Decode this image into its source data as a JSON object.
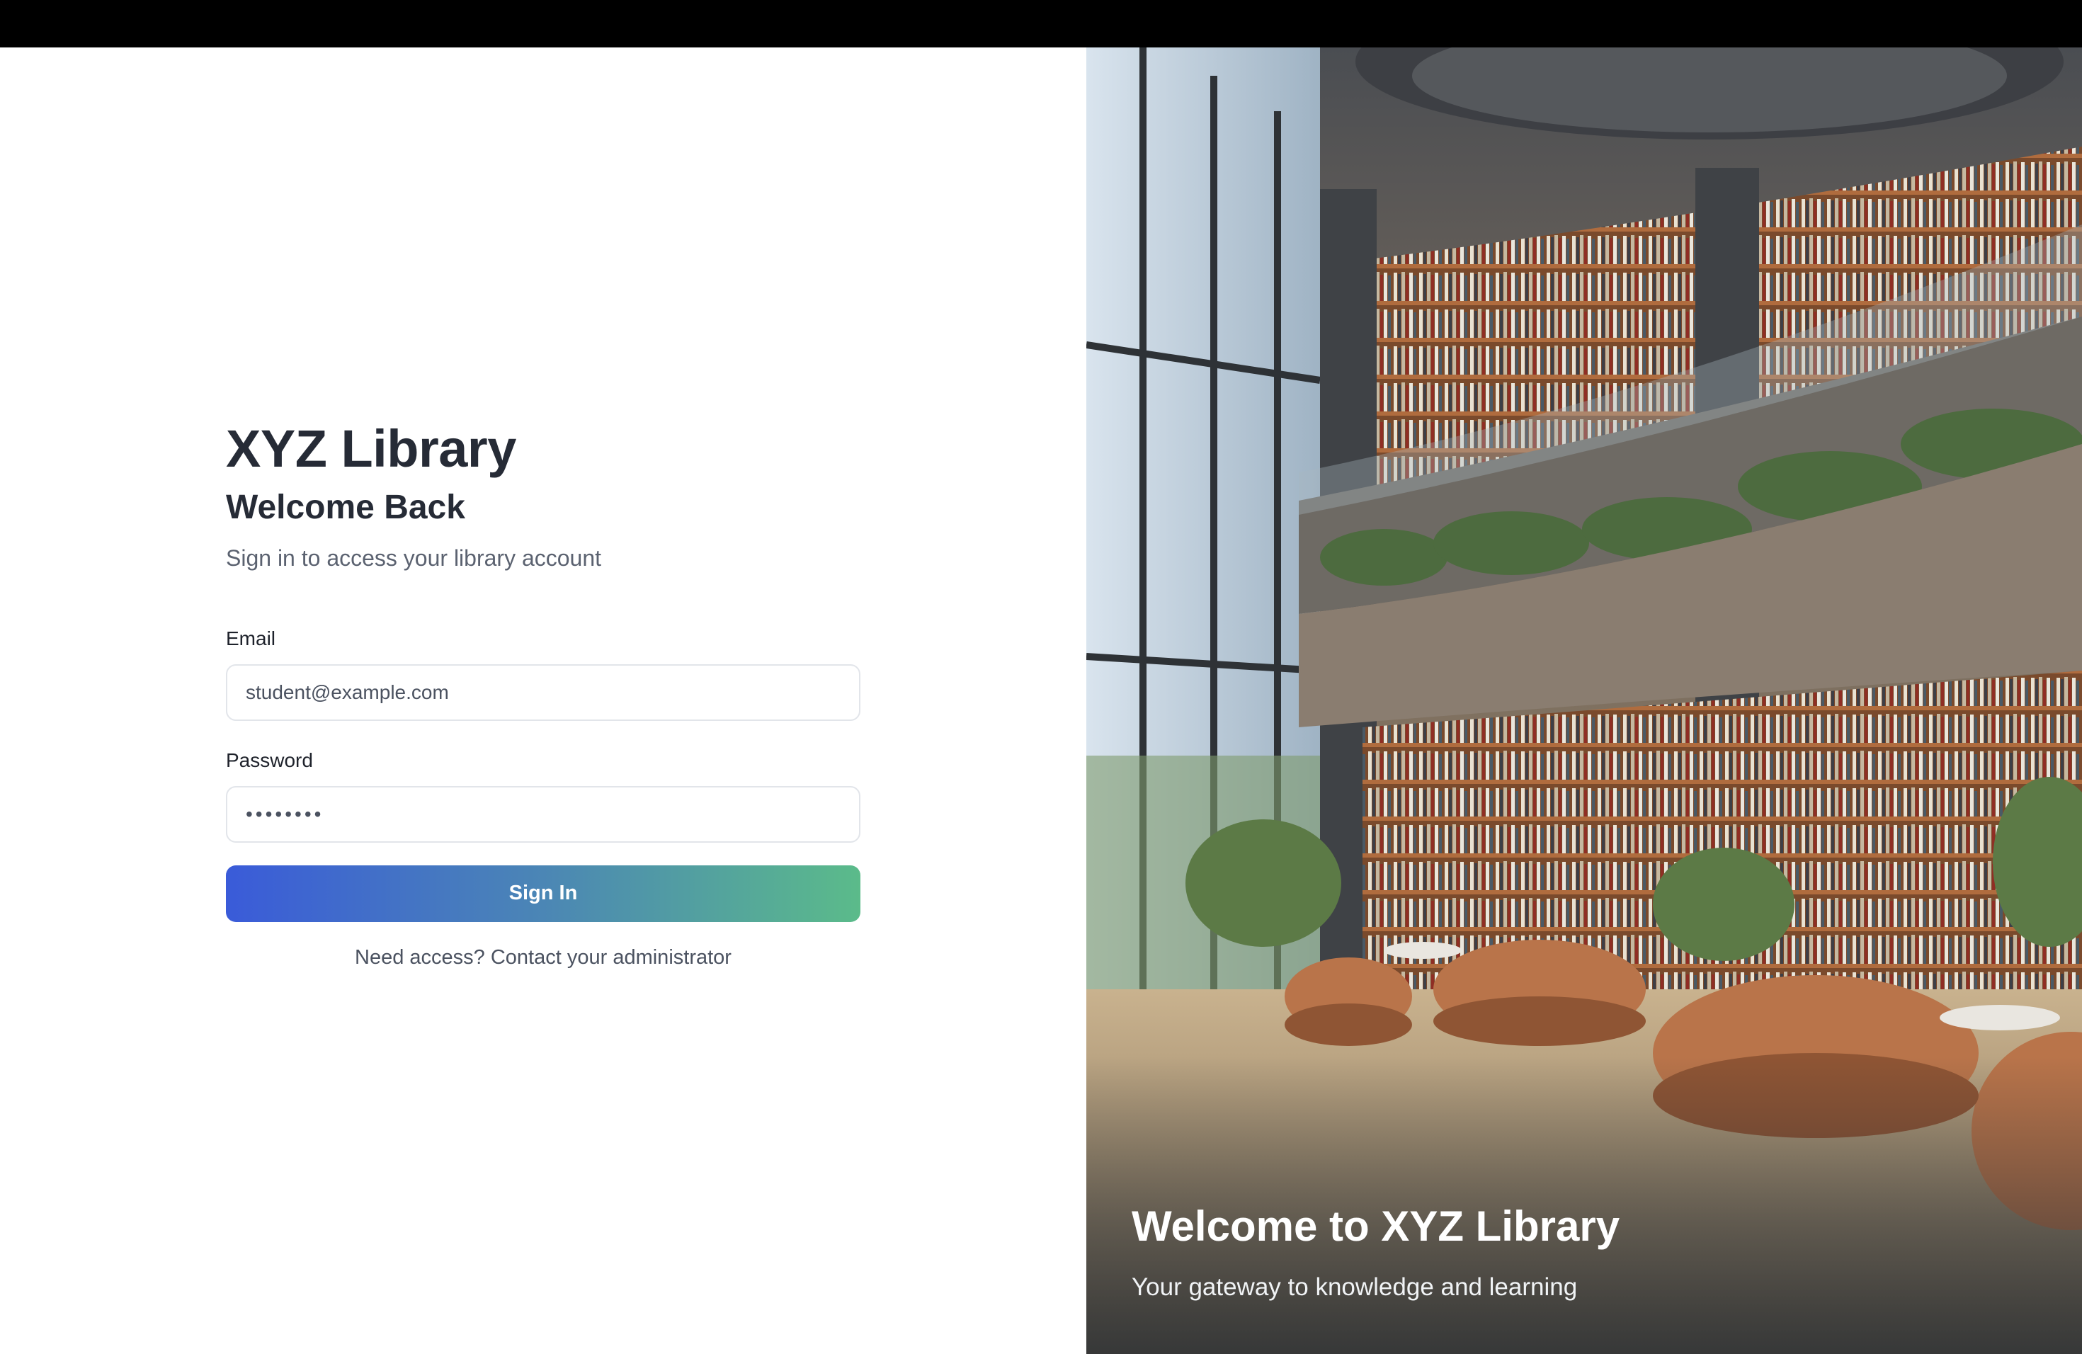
{
  "login": {
    "app_title": "XYZ Library",
    "welcome_title": "Welcome Back",
    "subtitle": "Sign in to access your library account",
    "email_label": "Email",
    "email_value": "student@example.com",
    "password_label": "Password",
    "password_value": "••••••••",
    "signin_label": "Sign In",
    "help_text": "Need access? Contact your administrator"
  },
  "hero": {
    "title": "Welcome to XYZ Library",
    "subtitle": "Your gateway to knowledge and learning",
    "image_icon": "library-interior-image"
  },
  "colors": {
    "text_dark": "#262b36",
    "text_muted": "#5b6270",
    "button_gradient_start": "#3a5bd9",
    "button_gradient_end": "#5bbb8a"
  }
}
